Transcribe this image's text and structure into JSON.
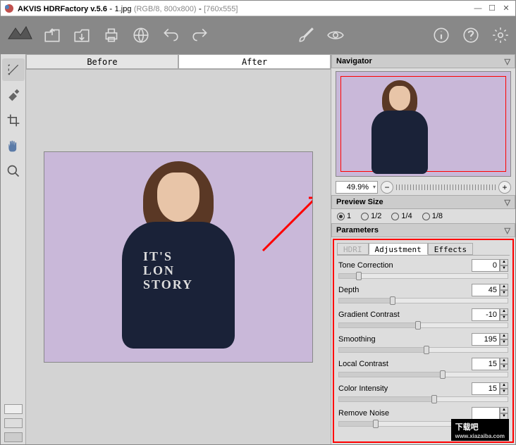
{
  "title": {
    "app": "AKVIS HDRFactory v.5.6",
    "file": "1.jpg",
    "mode": "(RGB/8, 800x800)",
    "dims": "[760x555]"
  },
  "tabs": {
    "before": "Before",
    "after": "After"
  },
  "navigator": {
    "label": "Navigator",
    "zoom": "49.9%"
  },
  "preview": {
    "label": "Preview Size",
    "opts": [
      "1",
      "1/2",
      "1/4",
      "1/8"
    ],
    "sel": 0
  },
  "parameters": {
    "label": "Parameters",
    "tabs": [
      "HDRI",
      "Adjustment",
      "Effects"
    ],
    "active": 1,
    "rows": [
      {
        "label": "Tone Correction",
        "val": "0",
        "pct": 10
      },
      {
        "label": "Depth",
        "val": "45",
        "pct": 30
      },
      {
        "label": "Gradient Contrast",
        "val": "-10",
        "pct": 45
      },
      {
        "label": "Smoothing",
        "val": "195",
        "pct": 50
      },
      {
        "label": "Local Contrast",
        "val": "15",
        "pct": 60
      },
      {
        "label": "Color Intensity",
        "val": "15",
        "pct": 55
      },
      {
        "label": "Remove Noise",
        "val": "",
        "pct": 20
      }
    ]
  },
  "watermark": {
    "cn": "下载吧",
    "url": "www.xiazaiba.com"
  },
  "imgtext": "IT'S\nLON\nSTORY"
}
